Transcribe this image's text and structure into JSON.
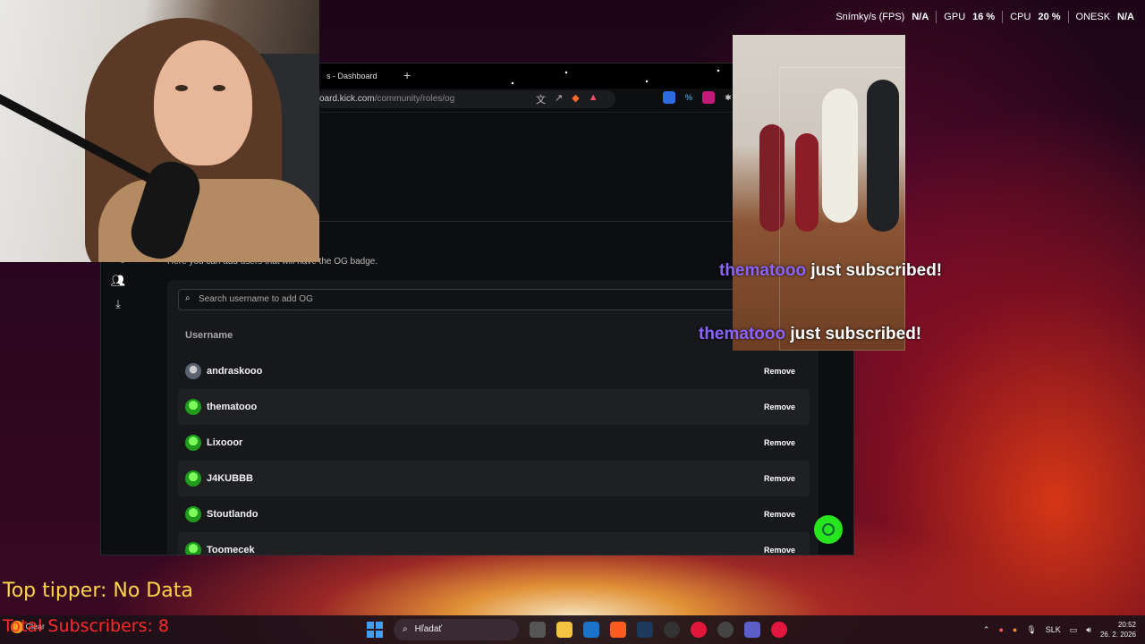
{
  "obs_stats": {
    "fps_label": "Snímky/s (FPS)",
    "fps_value": "N/A",
    "gpu_label": "GPU",
    "gpu_value": "16 %",
    "cpu_label": "CPU",
    "cpu_value": "20 %",
    "onesk_label": "ONESK",
    "onesk_value": "N/A"
  },
  "browser": {
    "tab_title": "s - Dashboard",
    "tab_new": "+",
    "address": {
      "host": "oard.kick.com",
      "path": "/community/roles/og"
    }
  },
  "page": {
    "description": "Here you can add users that will have the OG badge.",
    "search_placeholder": "Search username to add OG",
    "column_header": "Username",
    "remove_label": "Remove",
    "users": [
      {
        "name": "andraskooo",
        "avatar": "gray"
      },
      {
        "name": "thematooo",
        "avatar": "green"
      },
      {
        "name": "Lixooor",
        "avatar": "green"
      },
      {
        "name": "J4KUBBB",
        "avatar": "green"
      },
      {
        "name": "Stoutlando",
        "avatar": "green"
      },
      {
        "name": "Toomecek",
        "avatar": "green"
      }
    ]
  },
  "alerts": [
    {
      "user": "thematooo",
      "text": " just subscribed!"
    },
    {
      "user": "thematooo",
      "text": " just subscribed!"
    }
  ],
  "overlay": {
    "top_tipper": "Top tipper: No Data",
    "total_subscribers": "Total Subscribers: 8"
  },
  "taskbar": {
    "weather": "Clear",
    "search_label": "Hľadať",
    "language": "SLK",
    "time": "20:52",
    "date": "26. 2. 2026"
  },
  "colors": {
    "kick_green": "#26e51e",
    "alert_name": "#8b64ff",
    "tipper": "#ffd54a",
    "subs": "#ff2a2a"
  }
}
